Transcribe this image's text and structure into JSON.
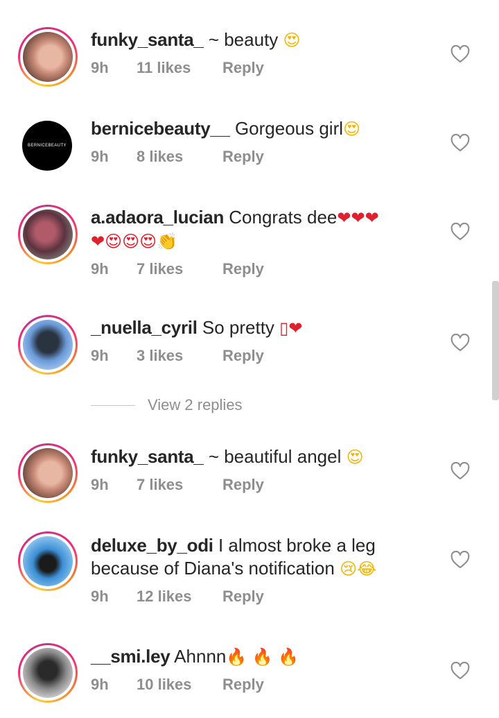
{
  "comments": [
    {
      "username": "funky_santa_",
      "text": " ~ beauty ",
      "emojis": "😍",
      "time": "9h",
      "likes": "11 likes",
      "reply": "Reply"
    },
    {
      "username": "bernicebeauty__",
      "text": " Gorgeous girl",
      "emojis": "😍",
      "time": "9h",
      "likes": "8 likes",
      "reply": "Reply",
      "avatar_text": "BERNICEBEAUTY"
    },
    {
      "username": "a.adaora_lucian",
      "text": " Congrats dee",
      "emojis": "❤❤❤",
      "emojis2": "❤😍😍😍👏",
      "time": "9h",
      "likes": "7 likes",
      "reply": "Reply"
    },
    {
      "username": "_nuella_cyril",
      "text": " So pretty ",
      "emojis": "▯❤",
      "time": "9h",
      "likes": "3 likes",
      "reply": "Reply"
    },
    {
      "username": "funky_santa_",
      "text": " ~ beautiful angel ",
      "emojis": "😍",
      "time": "9h",
      "likes": "7 likes",
      "reply": "Reply"
    },
    {
      "username": "deluxe_by_odi",
      "text": " I almost broke a leg",
      "text2": "because of Diana's notification ",
      "emojis": "😢😂",
      "time": "9h",
      "likes": "12 likes",
      "reply": "Reply"
    },
    {
      "username": "__smi.ley",
      "text": " Ahnnn",
      "emojis": "🔥 🔥 🔥",
      "time": "9h",
      "likes": "10 likes",
      "reply": "Reply"
    }
  ],
  "view_replies": "View 2 replies",
  "colors": {
    "heart": "#e0202e",
    "meta": "#8e8e8e",
    "ring_start": "#f9ce34",
    "ring_end": "#ee2a7b"
  },
  "icons": {
    "like": "heart-outline-icon"
  }
}
